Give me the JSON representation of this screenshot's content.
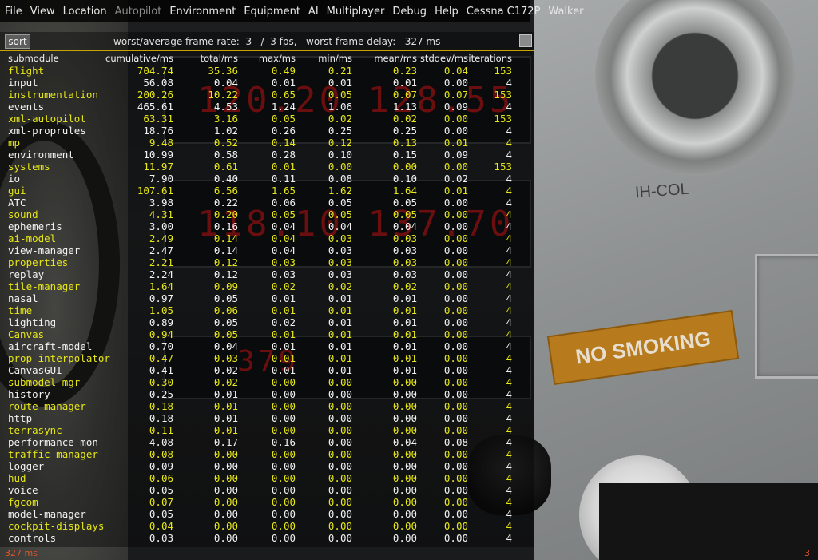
{
  "menu": {
    "items": [
      {
        "label": "File",
        "disabled": false
      },
      {
        "label": "View",
        "disabled": false
      },
      {
        "label": "Location",
        "disabled": false
      },
      {
        "label": "Autopilot",
        "disabled": true
      },
      {
        "label": "Environment",
        "disabled": false
      },
      {
        "label": "Equipment",
        "disabled": false
      },
      {
        "label": "AI",
        "disabled": false
      },
      {
        "label": "Multiplayer",
        "disabled": false
      },
      {
        "label": "Debug",
        "disabled": false
      },
      {
        "label": "Help",
        "disabled": false
      },
      {
        "label": "Cessna C172P",
        "disabled": false
      },
      {
        "label": "Walker",
        "disabled": false
      }
    ]
  },
  "monitor": {
    "sort_label": "sort",
    "framerate_text": "worst/average frame rate:  3   /  3 fps,   worst frame delay:   327 ms",
    "headers": [
      "submodule",
      "cumulative/ms",
      "total/ms",
      "max/ms",
      "min/ms",
      "mean/ms",
      "stddev/ms",
      "iterations"
    ],
    "rows": [
      {
        "name": "flight",
        "cumulative": "704.74",
        "total": "35.36",
        "max": "0.49",
        "min": "0.21",
        "mean": "0.23",
        "stddev": "0.04",
        "iterations": "153",
        "color": "yellow"
      },
      {
        "name": "input",
        "cumulative": "56.08",
        "total": "0.04",
        "max": "0.01",
        "min": "0.01",
        "mean": "0.01",
        "stddev": "0.00",
        "iterations": "4",
        "color": "white"
      },
      {
        "name": "instrumentation",
        "cumulative": "200.26",
        "total": "10.22",
        "max": "0.65",
        "min": "0.05",
        "mean": "0.07",
        "stddev": "0.07",
        "iterations": "153",
        "color": "yellow"
      },
      {
        "name": "events",
        "cumulative": "465.61",
        "total": "4.53",
        "max": "1.24",
        "min": "1.06",
        "mean": "1.13",
        "stddev": "0.09",
        "iterations": "4",
        "color": "white"
      },
      {
        "name": "xml-autopilot",
        "cumulative": "63.31",
        "total": "3.16",
        "max": "0.05",
        "min": "0.02",
        "mean": "0.02",
        "stddev": "0.00",
        "iterations": "153",
        "color": "yellow"
      },
      {
        "name": "xml-proprules",
        "cumulative": "18.76",
        "total": "1.02",
        "max": "0.26",
        "min": "0.25",
        "mean": "0.25",
        "stddev": "0.00",
        "iterations": "4",
        "color": "white"
      },
      {
        "name": "mp",
        "cumulative": "9.48",
        "total": "0.52",
        "max": "0.14",
        "min": "0.12",
        "mean": "0.13",
        "stddev": "0.01",
        "iterations": "4",
        "color": "yellow"
      },
      {
        "name": "environment",
        "cumulative": "10.99",
        "total": "0.58",
        "max": "0.28",
        "min": "0.10",
        "mean": "0.15",
        "stddev": "0.09",
        "iterations": "4",
        "color": "white"
      },
      {
        "name": "systems",
        "cumulative": "11.97",
        "total": "0.61",
        "max": "0.01",
        "min": "0.00",
        "mean": "0.00",
        "stddev": "0.00",
        "iterations": "153",
        "color": "yellow"
      },
      {
        "name": "io",
        "cumulative": "7.90",
        "total": "0.40",
        "max": "0.11",
        "min": "0.08",
        "mean": "0.10",
        "stddev": "0.02",
        "iterations": "4",
        "color": "white"
      },
      {
        "name": "gui",
        "cumulative": "107.61",
        "total": "6.56",
        "max": "1.65",
        "min": "1.62",
        "mean": "1.64",
        "stddev": "0.01",
        "iterations": "4",
        "color": "yellow"
      },
      {
        "name": "ATC",
        "cumulative": "3.98",
        "total": "0.22",
        "max": "0.06",
        "min": "0.05",
        "mean": "0.05",
        "stddev": "0.00",
        "iterations": "4",
        "color": "white"
      },
      {
        "name": "sound",
        "cumulative": "4.31",
        "total": "0.20",
        "max": "0.05",
        "min": "0.05",
        "mean": "0.05",
        "stddev": "0.00",
        "iterations": "4",
        "color": "yellow"
      },
      {
        "name": "ephemeris",
        "cumulative": "3.00",
        "total": "0.16",
        "max": "0.04",
        "min": "0.04",
        "mean": "0.04",
        "stddev": "0.00",
        "iterations": "4",
        "color": "white"
      },
      {
        "name": "ai-model",
        "cumulative": "2.49",
        "total": "0.14",
        "max": "0.04",
        "min": "0.03",
        "mean": "0.03",
        "stddev": "0.00",
        "iterations": "4",
        "color": "yellow"
      },
      {
        "name": "view-manager",
        "cumulative": "2.47",
        "total": "0.14",
        "max": "0.04",
        "min": "0.03",
        "mean": "0.03",
        "stddev": "0.00",
        "iterations": "4",
        "color": "white"
      },
      {
        "name": "properties",
        "cumulative": "2.21",
        "total": "0.12",
        "max": "0.03",
        "min": "0.03",
        "mean": "0.03",
        "stddev": "0.00",
        "iterations": "4",
        "color": "yellow"
      },
      {
        "name": "replay",
        "cumulative": "2.24",
        "total": "0.12",
        "max": "0.03",
        "min": "0.03",
        "mean": "0.03",
        "stddev": "0.00",
        "iterations": "4",
        "color": "white"
      },
      {
        "name": "tile-manager",
        "cumulative": "1.64",
        "total": "0.09",
        "max": "0.02",
        "min": "0.02",
        "mean": "0.02",
        "stddev": "0.00",
        "iterations": "4",
        "color": "yellow"
      },
      {
        "name": "nasal",
        "cumulative": "0.97",
        "total": "0.05",
        "max": "0.01",
        "min": "0.01",
        "mean": "0.01",
        "stddev": "0.00",
        "iterations": "4",
        "color": "white"
      },
      {
        "name": "time",
        "cumulative": "1.05",
        "total": "0.06",
        "max": "0.01",
        "min": "0.01",
        "mean": "0.01",
        "stddev": "0.00",
        "iterations": "4",
        "color": "yellow"
      },
      {
        "name": "lighting",
        "cumulative": "0.89",
        "total": "0.05",
        "max": "0.02",
        "min": "0.01",
        "mean": "0.01",
        "stddev": "0.00",
        "iterations": "4",
        "color": "white"
      },
      {
        "name": "Canvas",
        "cumulative": "0.94",
        "total": "0.05",
        "max": "0.01",
        "min": "0.01",
        "mean": "0.01",
        "stddev": "0.00",
        "iterations": "4",
        "color": "yellow"
      },
      {
        "name": "aircraft-model",
        "cumulative": "0.70",
        "total": "0.04",
        "max": "0.01",
        "min": "0.01",
        "mean": "0.01",
        "stddev": "0.00",
        "iterations": "4",
        "color": "white"
      },
      {
        "name": "prop-interpolator",
        "cumulative": "0.47",
        "total": "0.03",
        "max": "0.01",
        "min": "0.01",
        "mean": "0.01",
        "stddev": "0.00",
        "iterations": "4",
        "color": "yellow"
      },
      {
        "name": "CanvasGUI",
        "cumulative": "0.41",
        "total": "0.02",
        "max": "0.01",
        "min": "0.01",
        "mean": "0.01",
        "stddev": "0.00",
        "iterations": "4",
        "color": "white"
      },
      {
        "name": "submodel-mgr",
        "cumulative": "0.30",
        "total": "0.02",
        "max": "0.00",
        "min": "0.00",
        "mean": "0.00",
        "stddev": "0.00",
        "iterations": "4",
        "color": "yellow"
      },
      {
        "name": "history",
        "cumulative": "0.25",
        "total": "0.01",
        "max": "0.00",
        "min": "0.00",
        "mean": "0.00",
        "stddev": "0.00",
        "iterations": "4",
        "color": "white"
      },
      {
        "name": "route-manager",
        "cumulative": "0.18",
        "total": "0.01",
        "max": "0.00",
        "min": "0.00",
        "mean": "0.00",
        "stddev": "0.00",
        "iterations": "4",
        "color": "yellow"
      },
      {
        "name": "http",
        "cumulative": "0.18",
        "total": "0.01",
        "max": "0.00",
        "min": "0.00",
        "mean": "0.00",
        "stddev": "0.00",
        "iterations": "4",
        "color": "white"
      },
      {
        "name": "terrasync",
        "cumulative": "0.11",
        "total": "0.01",
        "max": "0.00",
        "min": "0.00",
        "mean": "0.00",
        "stddev": "0.00",
        "iterations": "4",
        "color": "yellow"
      },
      {
        "name": "performance-mon",
        "cumulative": "4.08",
        "total": "0.17",
        "max": "0.16",
        "min": "0.00",
        "mean": "0.04",
        "stddev": "0.08",
        "iterations": "4",
        "color": "white"
      },
      {
        "name": "traffic-manager",
        "cumulative": "0.08",
        "total": "0.00",
        "max": "0.00",
        "min": "0.00",
        "mean": "0.00",
        "stddev": "0.00",
        "iterations": "4",
        "color": "yellow"
      },
      {
        "name": "logger",
        "cumulative": "0.09",
        "total": "0.00",
        "max": "0.00",
        "min": "0.00",
        "mean": "0.00",
        "stddev": "0.00",
        "iterations": "4",
        "color": "white"
      },
      {
        "name": "hud",
        "cumulative": "0.06",
        "total": "0.00",
        "max": "0.00",
        "min": "0.00",
        "mean": "0.00",
        "stddev": "0.00",
        "iterations": "4",
        "color": "yellow"
      },
      {
        "name": "voice",
        "cumulative": "0.05",
        "total": "0.00",
        "max": "0.00",
        "min": "0.00",
        "mean": "0.00",
        "stddev": "0.00",
        "iterations": "4",
        "color": "white"
      },
      {
        "name": "fgcom",
        "cumulative": "0.07",
        "total": "0.00",
        "max": "0.00",
        "min": "0.00",
        "mean": "0.00",
        "stddev": "0.00",
        "iterations": "4",
        "color": "yellow"
      },
      {
        "name": "model-manager",
        "cumulative": "0.05",
        "total": "0.00",
        "max": "0.00",
        "min": "0.00",
        "mean": "0.00",
        "stddev": "0.00",
        "iterations": "4",
        "color": "white"
      },
      {
        "name": "cockpit-displays",
        "cumulative": "0.04",
        "total": "0.00",
        "max": "0.00",
        "min": "0.00",
        "mean": "0.00",
        "stddev": "0.00",
        "iterations": "4",
        "color": "yellow"
      },
      {
        "name": "controls",
        "cumulative": "0.03",
        "total": "0.00",
        "max": "0.00",
        "min": "0.00",
        "mean": "0.00",
        "stddev": "0.00",
        "iterations": "4",
        "color": "white"
      }
    ]
  },
  "footer": {
    "left": "327 ms",
    "right": "3"
  },
  "scene": {
    "radio_display_1": "120.20 128.55",
    "radio_display_2": "118.80 117.90",
    "radio_display_3": "118.10 137.70",
    "radio_display_4": "116.80 139.50",
    "adf_display": "379",
    "panel_label": "IH-COL",
    "sign_text": "NO SMOKING"
  },
  "colors": {
    "row_white": "#f2f2f2",
    "row_yellow": "#e6e619",
    "divider": "#c8a400",
    "footer": "#e0552b"
  }
}
